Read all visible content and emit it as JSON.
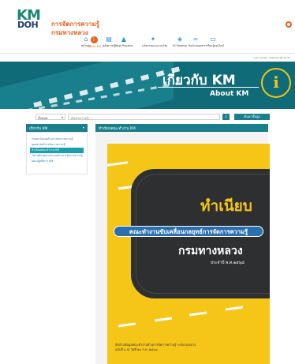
{
  "brand": {
    "logo_top": "KM",
    "logo_bottom": "DOH",
    "title_line1": "การจัดการความรู้",
    "title_line2": "กรมทางหลวง"
  },
  "nav": {
    "items": [
      {
        "label": "หน้าแรก",
        "icon": "home-icon",
        "glyph": "⌂"
      },
      {
        "label": "เกี่ยวกับ KM",
        "icon": "info-icon",
        "glyph": "i",
        "active": true
      },
      {
        "label": "คลังความรู้",
        "icon": "book-icon",
        "glyph": "▤"
      },
      {
        "label": "Best Practice",
        "icon": "thumbs-up-icon",
        "glyph": "▲"
      },
      {
        "label": "นวัตกรรมและงานวิจัย",
        "icon": "lightbulb-icon",
        "glyph": "✦"
      },
      {
        "label": "KI Sharing",
        "icon": "share-icon",
        "glyph": "◈"
      },
      {
        "label": "ลิงก์ภายนอก",
        "icon": "link-icon",
        "glyph": "∞"
      },
      {
        "label": "การเรียนรู้ออนไลน์",
        "icon": "laptop-icon",
        "glyph": "▭"
      }
    ]
  },
  "update_text": "Last update: 2026-09-06 14:35",
  "banner": {
    "title_th": "เกี่ยวกับ KM",
    "title_en": "About KM"
  },
  "search": {
    "filter_value": "ทั้งหมด",
    "placeholder": "ค้นหาความรู้...",
    "search_icon": "search-icon",
    "advanced_label": "ค้นหาขั้นสูง"
  },
  "sidebar": {
    "title": "เกี่ยวกับ KM",
    "items": [
      {
        "label": "กรอบนโยบายด้านการจัดการความรู้"
      },
      {
        "label": "ยุทธศาสตร์การจัดการความรู้"
      },
      {
        "label": "ทำเนียบคณะทำงาน KM",
        "active": true
      },
      {
        "label": "โครงสร้างคณะทำงานด้านการจัดการความรู้"
      },
      {
        "label": "แผนปฏิบัติการ KM"
      }
    ]
  },
  "main": {
    "title": "ทำเนียบคณะทำงาน KM",
    "cover": {
      "title": "ทำเนียบ",
      "subtitle": "คณะทำงานขับเคลื่อนกลยุทธ์การจัดการความรู้",
      "org": "กรมทางหลวง",
      "year": "ประจำปี พ.ศ.๒๕๖๘",
      "footer_line1": "สัดส่วนข้อมูลคณะทำงานด้านการจัดการความรู้ ระดับกองกลาง",
      "footer_line2": "ฉบับที่ ๑ ณ วันที่ ๒๔ ก.พ. ๒๕๖๘"
    }
  },
  "colors": {
    "teal": "#1a7f8c",
    "orange": "#e8601c",
    "yellow": "#f5c518",
    "blue": "#2a6fb0"
  }
}
